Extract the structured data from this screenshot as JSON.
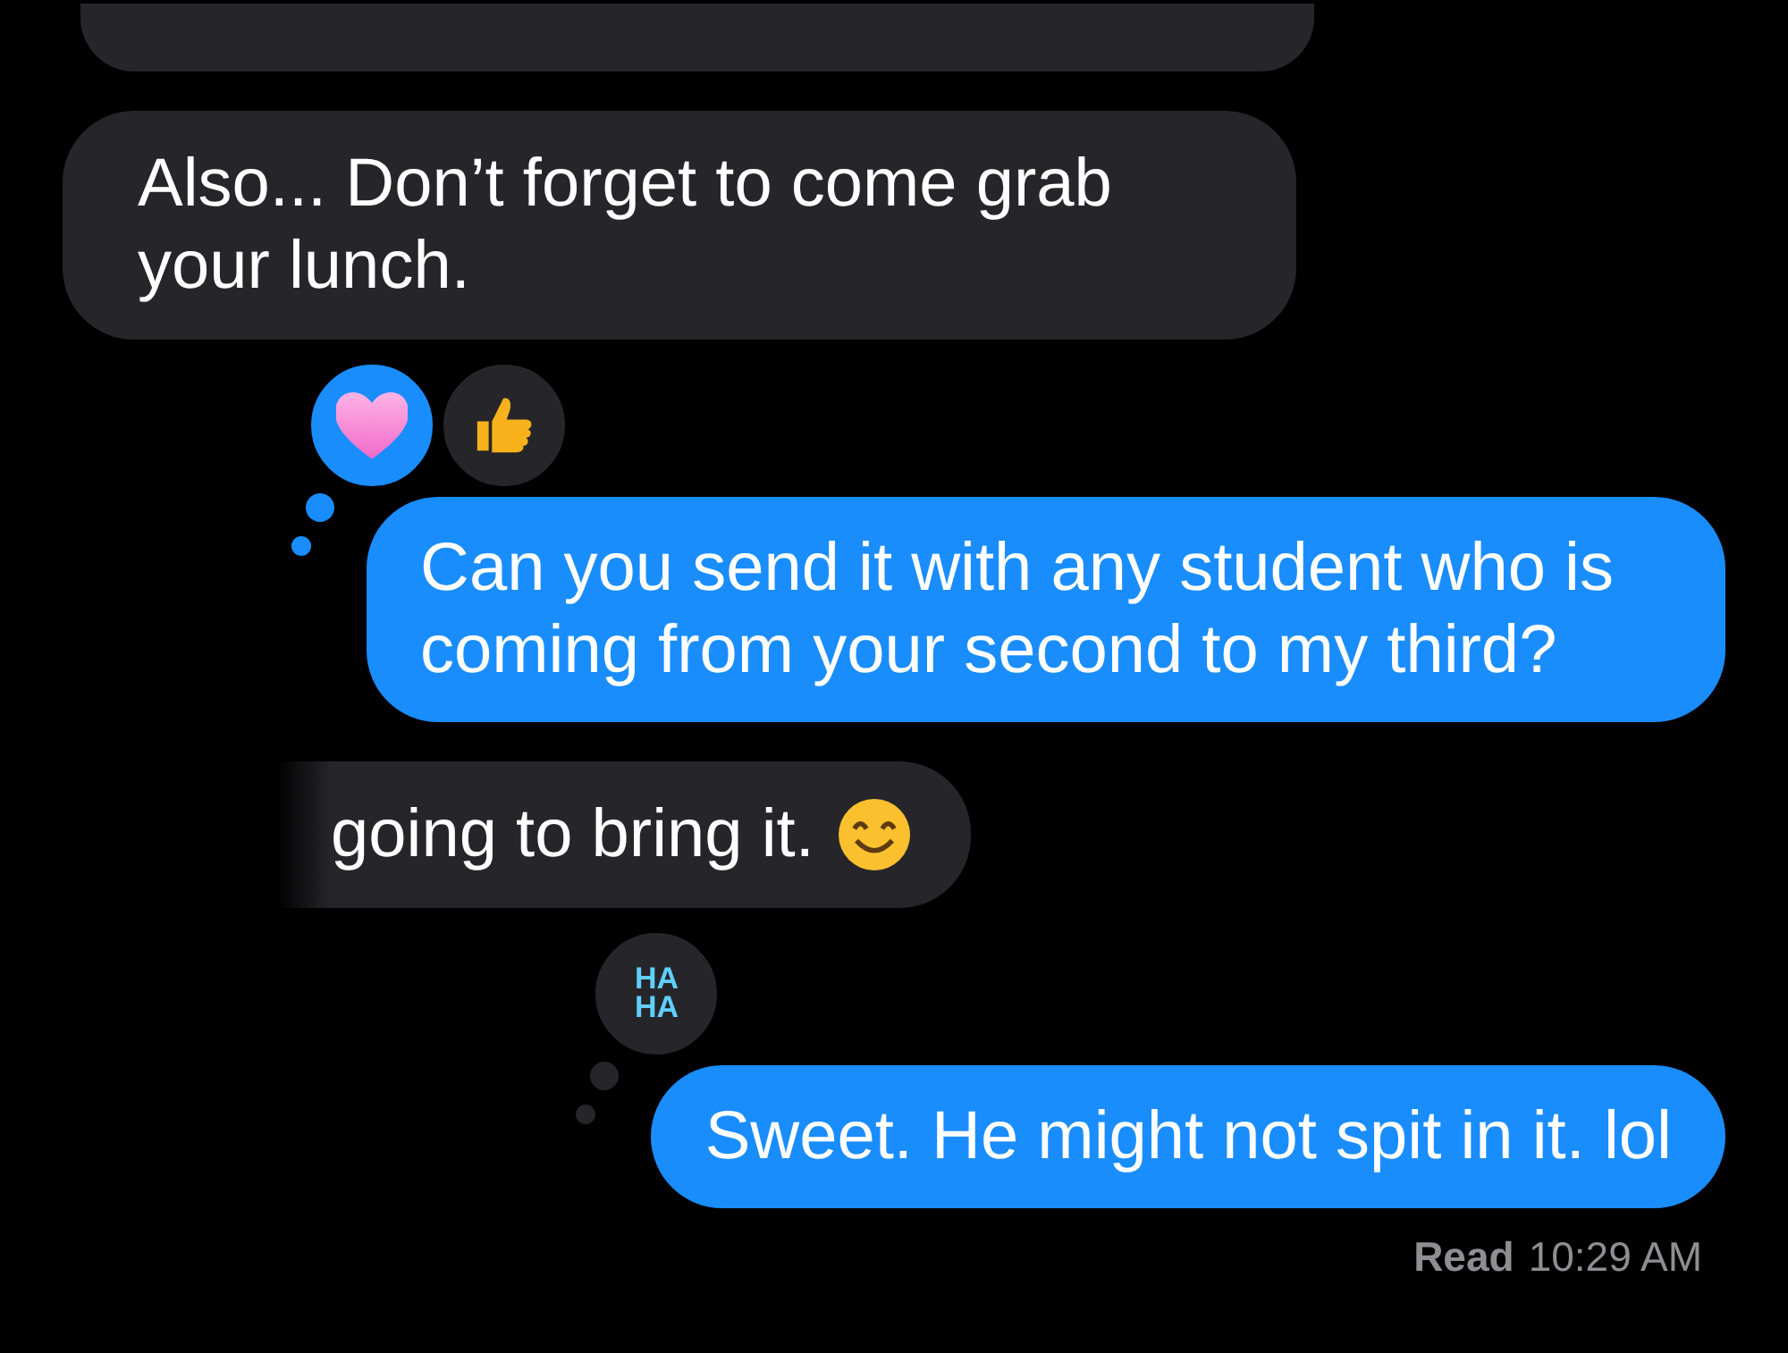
{
  "messages": [
    {
      "kind": "incoming",
      "cropped": true
    },
    {
      "kind": "incoming",
      "text": "Also... Don’t forget to come grab your lunch."
    },
    {
      "kind": "outgoing",
      "text": "Can you send it with any student who is coming from your second to my third?",
      "reactions": [
        {
          "kind": "heart",
          "mine": true
        },
        {
          "kind": "thumbs-up",
          "mine": false
        }
      ]
    },
    {
      "kind": "incoming",
      "text": "going to bring it.",
      "redacted": true,
      "emoji": {
        "kind": "smile"
      }
    },
    {
      "kind": "outgoing",
      "text": "Sweet. He might not spit in it. lol",
      "reactions": [
        {
          "kind": "haha",
          "mine": false,
          "lines": [
            "HA",
            "HA"
          ]
        }
      ]
    }
  ],
  "receipt": {
    "status": "Read",
    "time": "10:29 AM"
  }
}
